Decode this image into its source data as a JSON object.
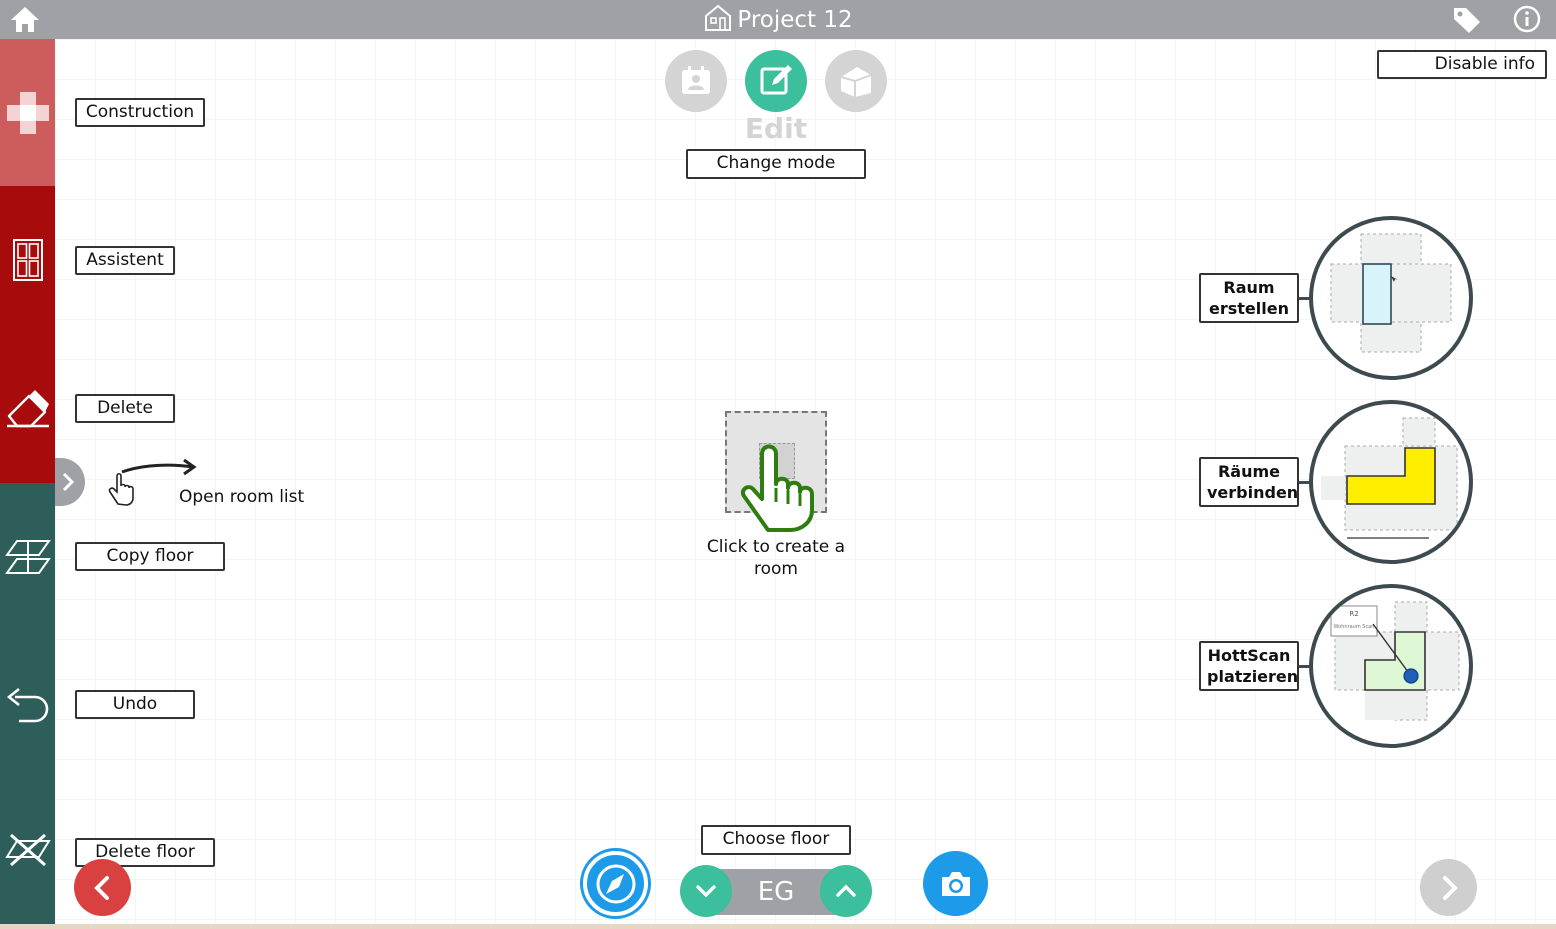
{
  "header": {
    "title": "Project 12",
    "home_icon": "home-icon",
    "project_icon": "house-icon",
    "tag_icon": "tag-icon",
    "info_icon": "info-icon"
  },
  "sidebar": {
    "items": [
      {
        "name": "construction",
        "icon": "plus-icon",
        "label": "Construction",
        "color": "#cd5c5c"
      },
      {
        "name": "assistent",
        "icon": "window-icon",
        "label": "Assistent",
        "color": "#a70b0b"
      },
      {
        "name": "delete",
        "icon": "eraser-icon",
        "label": "Delete",
        "color": "#a70b0b"
      },
      {
        "name": "copy-floor",
        "icon": "copy-floor-icon",
        "label": "Copy floor",
        "color": "#2e5e5a"
      },
      {
        "name": "undo",
        "icon": "undo-icon",
        "label": "Undo",
        "color": "#2e5e5a"
      },
      {
        "name": "delete-floor",
        "icon": "delete-floor-icon",
        "label": "Delete floor",
        "color": "#2e5e5a"
      }
    ]
  },
  "mode": {
    "current": "Edit",
    "change_label": "Change mode",
    "buttons": [
      "contact-card-icon",
      "edit-icon",
      "3d-house-icon"
    ]
  },
  "disable_info": "Disable info",
  "room_list_hint": "Open room list",
  "create_room_hint": "Click to create a room",
  "floor": {
    "choose_label": "Choose floor",
    "current": "EG"
  },
  "previews": [
    {
      "label": "Raum erstellen"
    },
    {
      "label": "Räume verbinden"
    },
    {
      "label": "HottScan platzieren",
      "tiny_label_1": "R2",
      "tiny_label_2": "Wohnraum Scan"
    }
  ],
  "colors": {
    "topbar": "#9ea1a5",
    "accent_green": "#3bbf9c",
    "accent_blue": "#1d9be8",
    "danger_red": "#d94141",
    "hand_green": "#2e7d0f"
  }
}
